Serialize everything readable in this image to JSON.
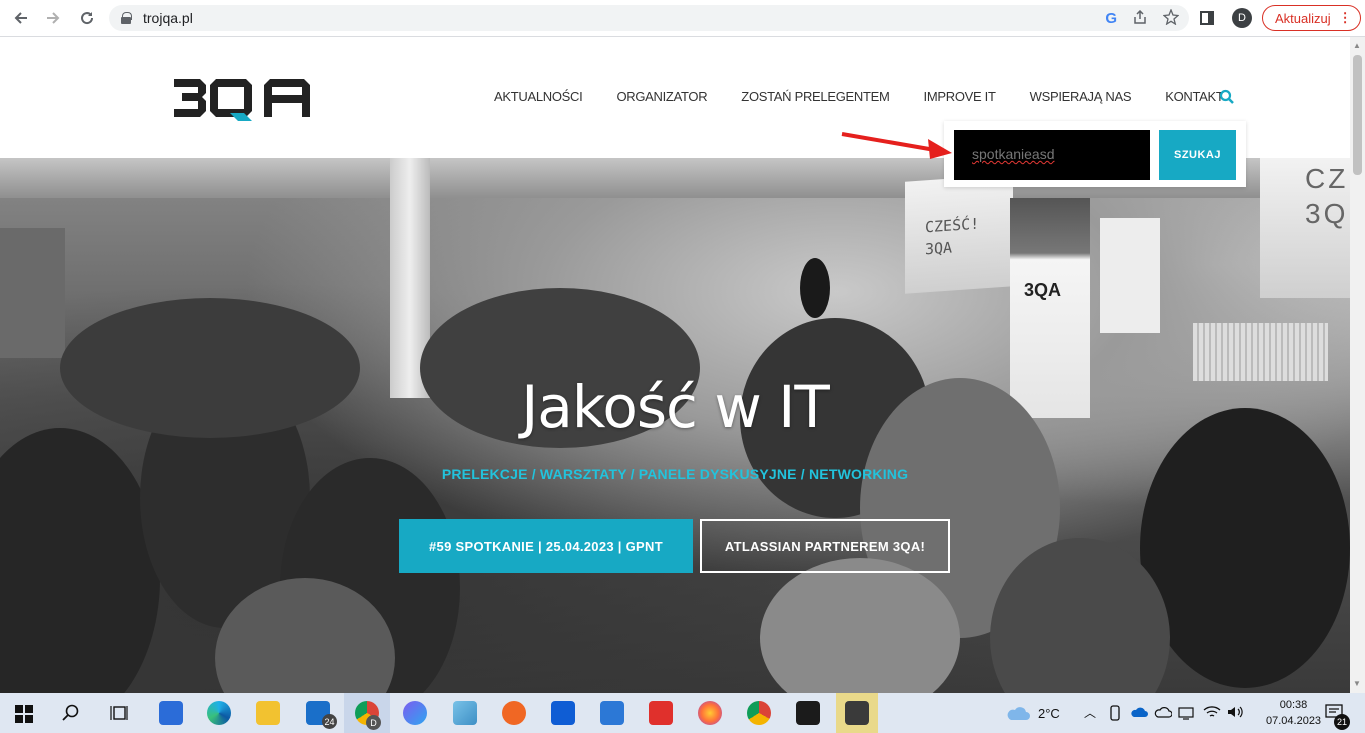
{
  "browser": {
    "url": "trojqa.pl",
    "update_label": "Aktualizuj",
    "profile_initial": "D"
  },
  "site": {
    "logo_text": "3QA",
    "nav": [
      "AKTUALNOŚCI",
      "ORGANIZATOR",
      "ZOSTAŃ PRELEGENTEM",
      "IMPROVE IT",
      "WSPIERAJĄ NAS",
      "KONTAKT"
    ],
    "search": {
      "value": "spotkanieasd",
      "button_label": "SZUKAJ"
    }
  },
  "hero": {
    "title": "Jakość w IT",
    "subtitle": "PRELEKCJE / WARSZTATY / PANELE DYSKUSYJNE / NETWORKING",
    "primary_button": "#59 SPOTKANIE | 25.04.2023 | GPNT",
    "secondary_button": "ATLASSIAN PARTNEREM 3QA!",
    "background_texts": [
      "CZEŚĆ!",
      "3QA",
      "CZ",
      "3Q",
      "3QA"
    ]
  },
  "taskbar": {
    "mail_badge": "24",
    "chrome_badge": "D",
    "weather": "2°C",
    "time": "00:38",
    "date": "07.04.2023",
    "notification_count": "21"
  },
  "colors": {
    "accent": "#17a9c4",
    "subtitle": "#22c3dc",
    "update_red": "#d93025"
  }
}
